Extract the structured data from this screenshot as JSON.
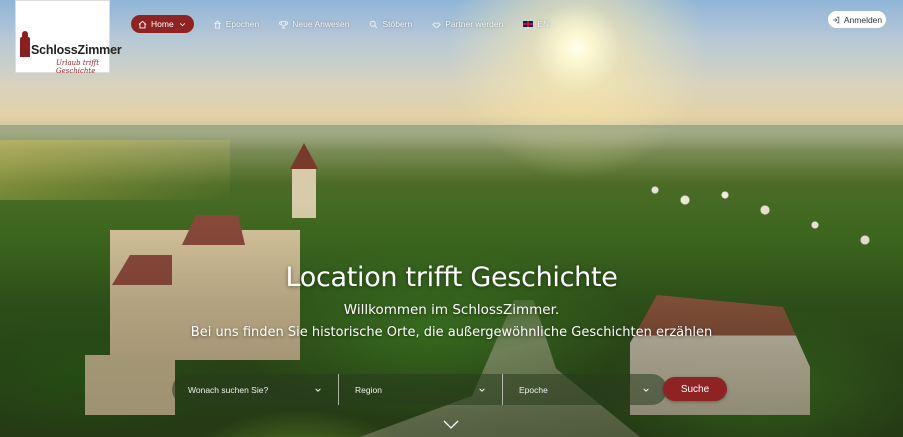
{
  "brand": {
    "logo_text": "SchlossZimmer",
    "tagline": "Urlaub trifft Geschichte"
  },
  "nav": {
    "items": [
      {
        "label": "Home",
        "icon": "home-icon",
        "active": true
      },
      {
        "label": "Epochen",
        "icon": "epochs-icon"
      },
      {
        "label": "Neue Anwesen",
        "icon": "trophy-icon"
      },
      {
        "label": "Stöbern",
        "icon": "search-icon"
      },
      {
        "label": "Partner werden",
        "icon": "handshake-icon"
      },
      {
        "label": "EN",
        "icon": "uk-flag-icon"
      }
    ],
    "login_label": "Anmelden"
  },
  "hero": {
    "title": "Location trifft Geschichte",
    "subtitle": "Willkommen im SchlossZimmer.",
    "description": "Bei uns finden Sie historische Orte, die außergewöhnliche Geschichten erzählen"
  },
  "search": {
    "what_placeholder": "Wonach suchen Sie?",
    "region_placeholder": "Region",
    "epoch_placeholder": "Epoche",
    "button_label": "Suche"
  },
  "colors": {
    "accent": "#8f2323"
  }
}
